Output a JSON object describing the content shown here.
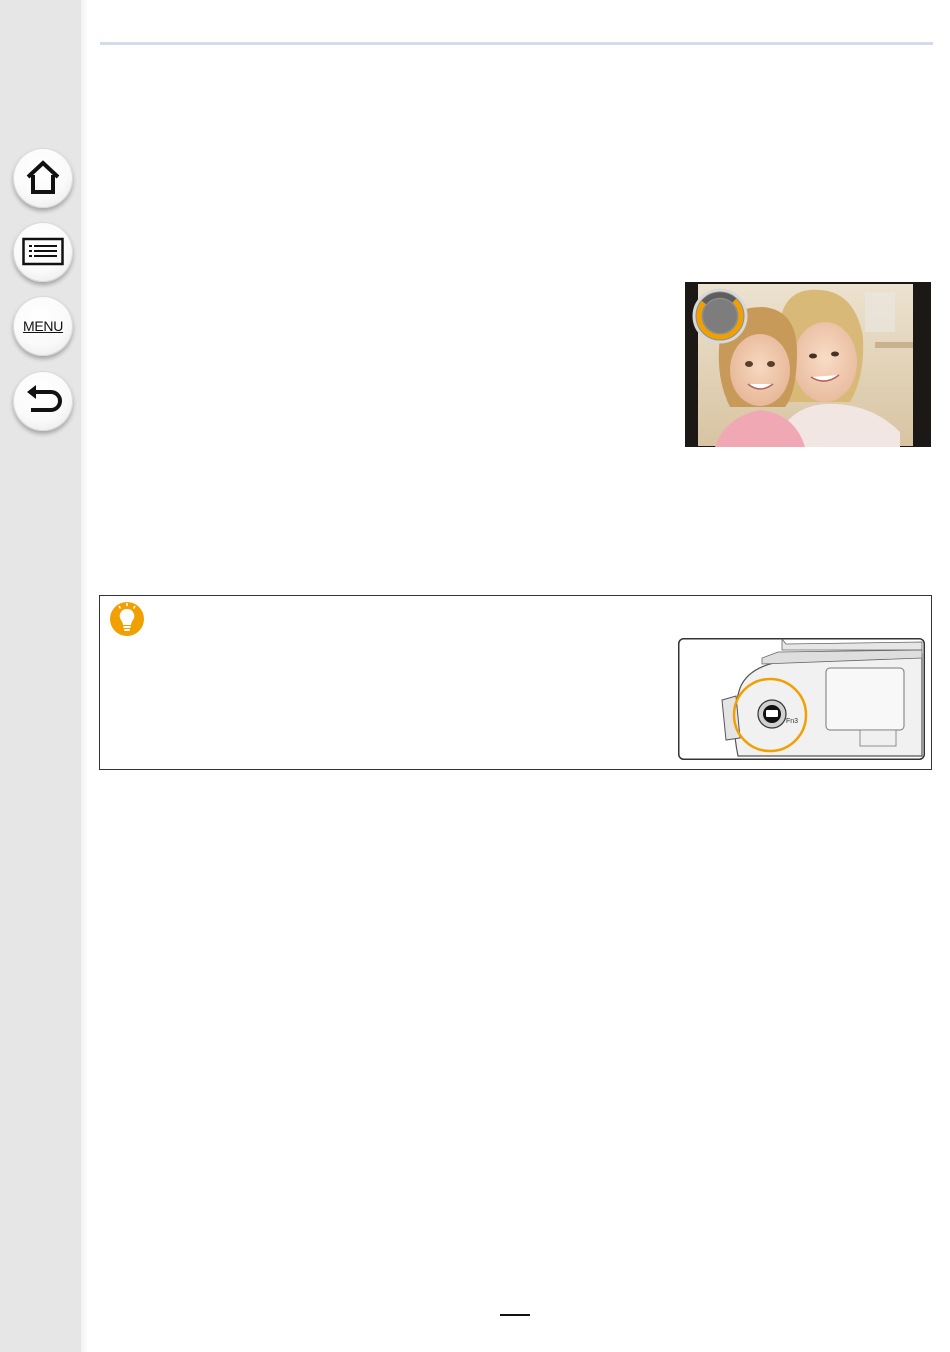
{
  "sidebar": {
    "buttons": [
      {
        "icon": "home-icon",
        "label": ""
      },
      {
        "icon": "contents-list-icon",
        "label": ""
      },
      {
        "icon": "menu-icon",
        "label": "MENU"
      },
      {
        "icon": "back-arrow-icon",
        "label": ""
      }
    ]
  },
  "colors": {
    "sidebar_bg": "#e6e6e6",
    "header_rule": "#d4dbea",
    "accent_orange": "#f0a000",
    "tip_icon_orange": "#f0a000"
  },
  "photo": {
    "subject": "mother-and-daughter-portrait",
    "overlay_icon": "focus-progress-ring-icon"
  },
  "tip_box": {
    "icon": "lightbulb-icon",
    "illustration": "camera-top-fn-button-illustration",
    "button_label": "Fn3"
  }
}
